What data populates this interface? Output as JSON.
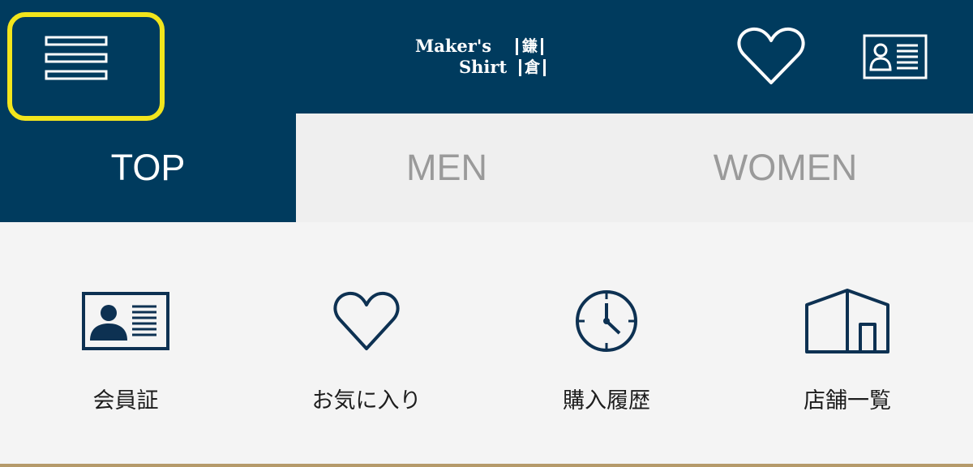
{
  "header": {
    "background": "#003b5e",
    "highlight_color": "#f2e51c",
    "menu_icon": "hamburger-menu-icon",
    "logo": {
      "line1": "Maker's",
      "line2": "Shirt",
      "kanji1": "鎌",
      "kanji2": "倉"
    },
    "favorites_icon": "heart-icon",
    "member_card_icon": "member-card-icon"
  },
  "tabs": [
    {
      "label": "TOP",
      "active": true
    },
    {
      "label": "MEN",
      "active": false
    },
    {
      "label": "WOMEN",
      "active": false
    }
  ],
  "quick_links": [
    {
      "label": "会員証",
      "icon": "member-card-icon"
    },
    {
      "label": "お気に入り",
      "icon": "heart-icon"
    },
    {
      "label": "購入履歴",
      "icon": "clock-icon"
    },
    {
      "label": "店舗一覧",
      "icon": "store-icon"
    }
  ]
}
